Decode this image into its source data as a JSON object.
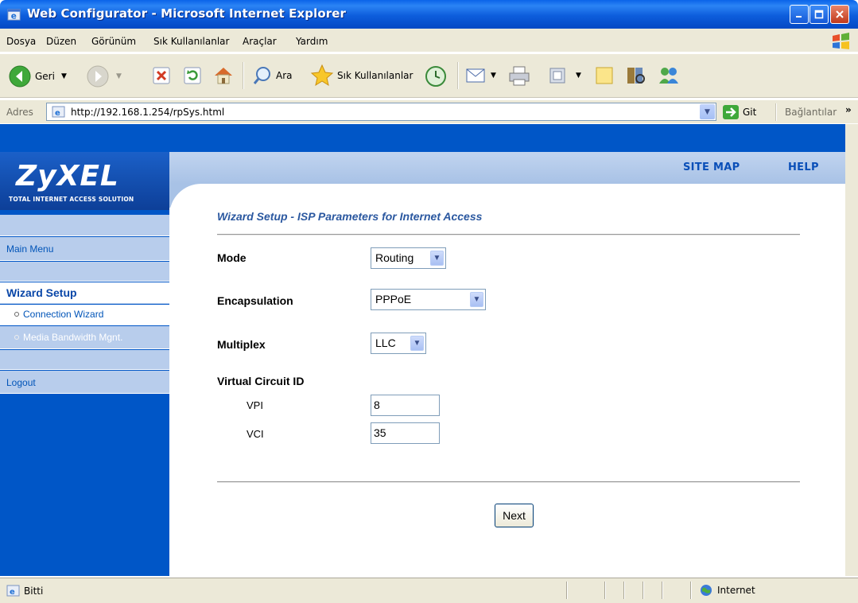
{
  "window": {
    "title": "Web Configurator - Microsoft Internet Explorer"
  },
  "menubar": {
    "items": [
      "Dosya",
      "Düzen",
      "Görünüm",
      "Sık Kullanılanlar",
      "Araçlar",
      "Yardım"
    ]
  },
  "toolbar": {
    "back": "Geri",
    "search": "Ara",
    "favorites": "Sık Kullanılanlar"
  },
  "addressbar": {
    "label": "Adres",
    "url": "http://192.168.1.254/rpSys.html",
    "go": "Git",
    "links": "Bağlantılar"
  },
  "header": {
    "logo": "ZyXEL",
    "tagline": "TOTAL INTERNET ACCESS SOLUTION",
    "site_map": "SITE MAP",
    "help": "HELP"
  },
  "sidebar": {
    "main_menu": "Main Menu",
    "wizard_setup": "Wizard Setup",
    "connection_wizard": "Connection Wizard",
    "media_bandwidth": "Media Bandwidth Mgnt.",
    "logout": "Logout"
  },
  "main": {
    "heading": "Wizard Setup - ISP Parameters for Internet Access",
    "mode_label": "Mode",
    "mode_value": "Routing",
    "encapsulation_label": "Encapsulation",
    "encapsulation_value": "PPPoE",
    "multiplex_label": "Multiplex",
    "multiplex_value": "LLC",
    "vc_label": "Virtual Circuit ID",
    "vpi_label": "VPI",
    "vpi_value": "8",
    "vci_label": "VCI",
    "vci_value": "35",
    "next_label": "Next"
  },
  "statusbar": {
    "status": "Bitti",
    "zone": "Internet"
  },
  "colors": {
    "sidebar_blue": "#0056c7",
    "band_blue": "#b8cdec",
    "heading_blue": "#2b58a0"
  }
}
